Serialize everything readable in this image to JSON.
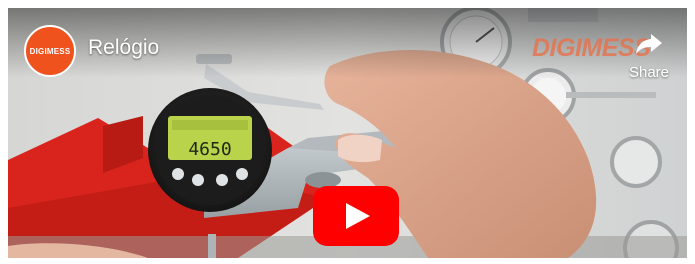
{
  "video": {
    "title": "Relógio",
    "channel_avatar_text": "DIGIMESS",
    "brand_watermark": "DIGIMESS",
    "share_label": "Share",
    "display_reading": "4650"
  },
  "colors": {
    "youtube_red": "#ff0000",
    "avatar_orange": "#f0521e",
    "lcd_green": "#b9d34a"
  },
  "icons": {
    "share": "share-arrow-icon",
    "play": "play-icon"
  }
}
